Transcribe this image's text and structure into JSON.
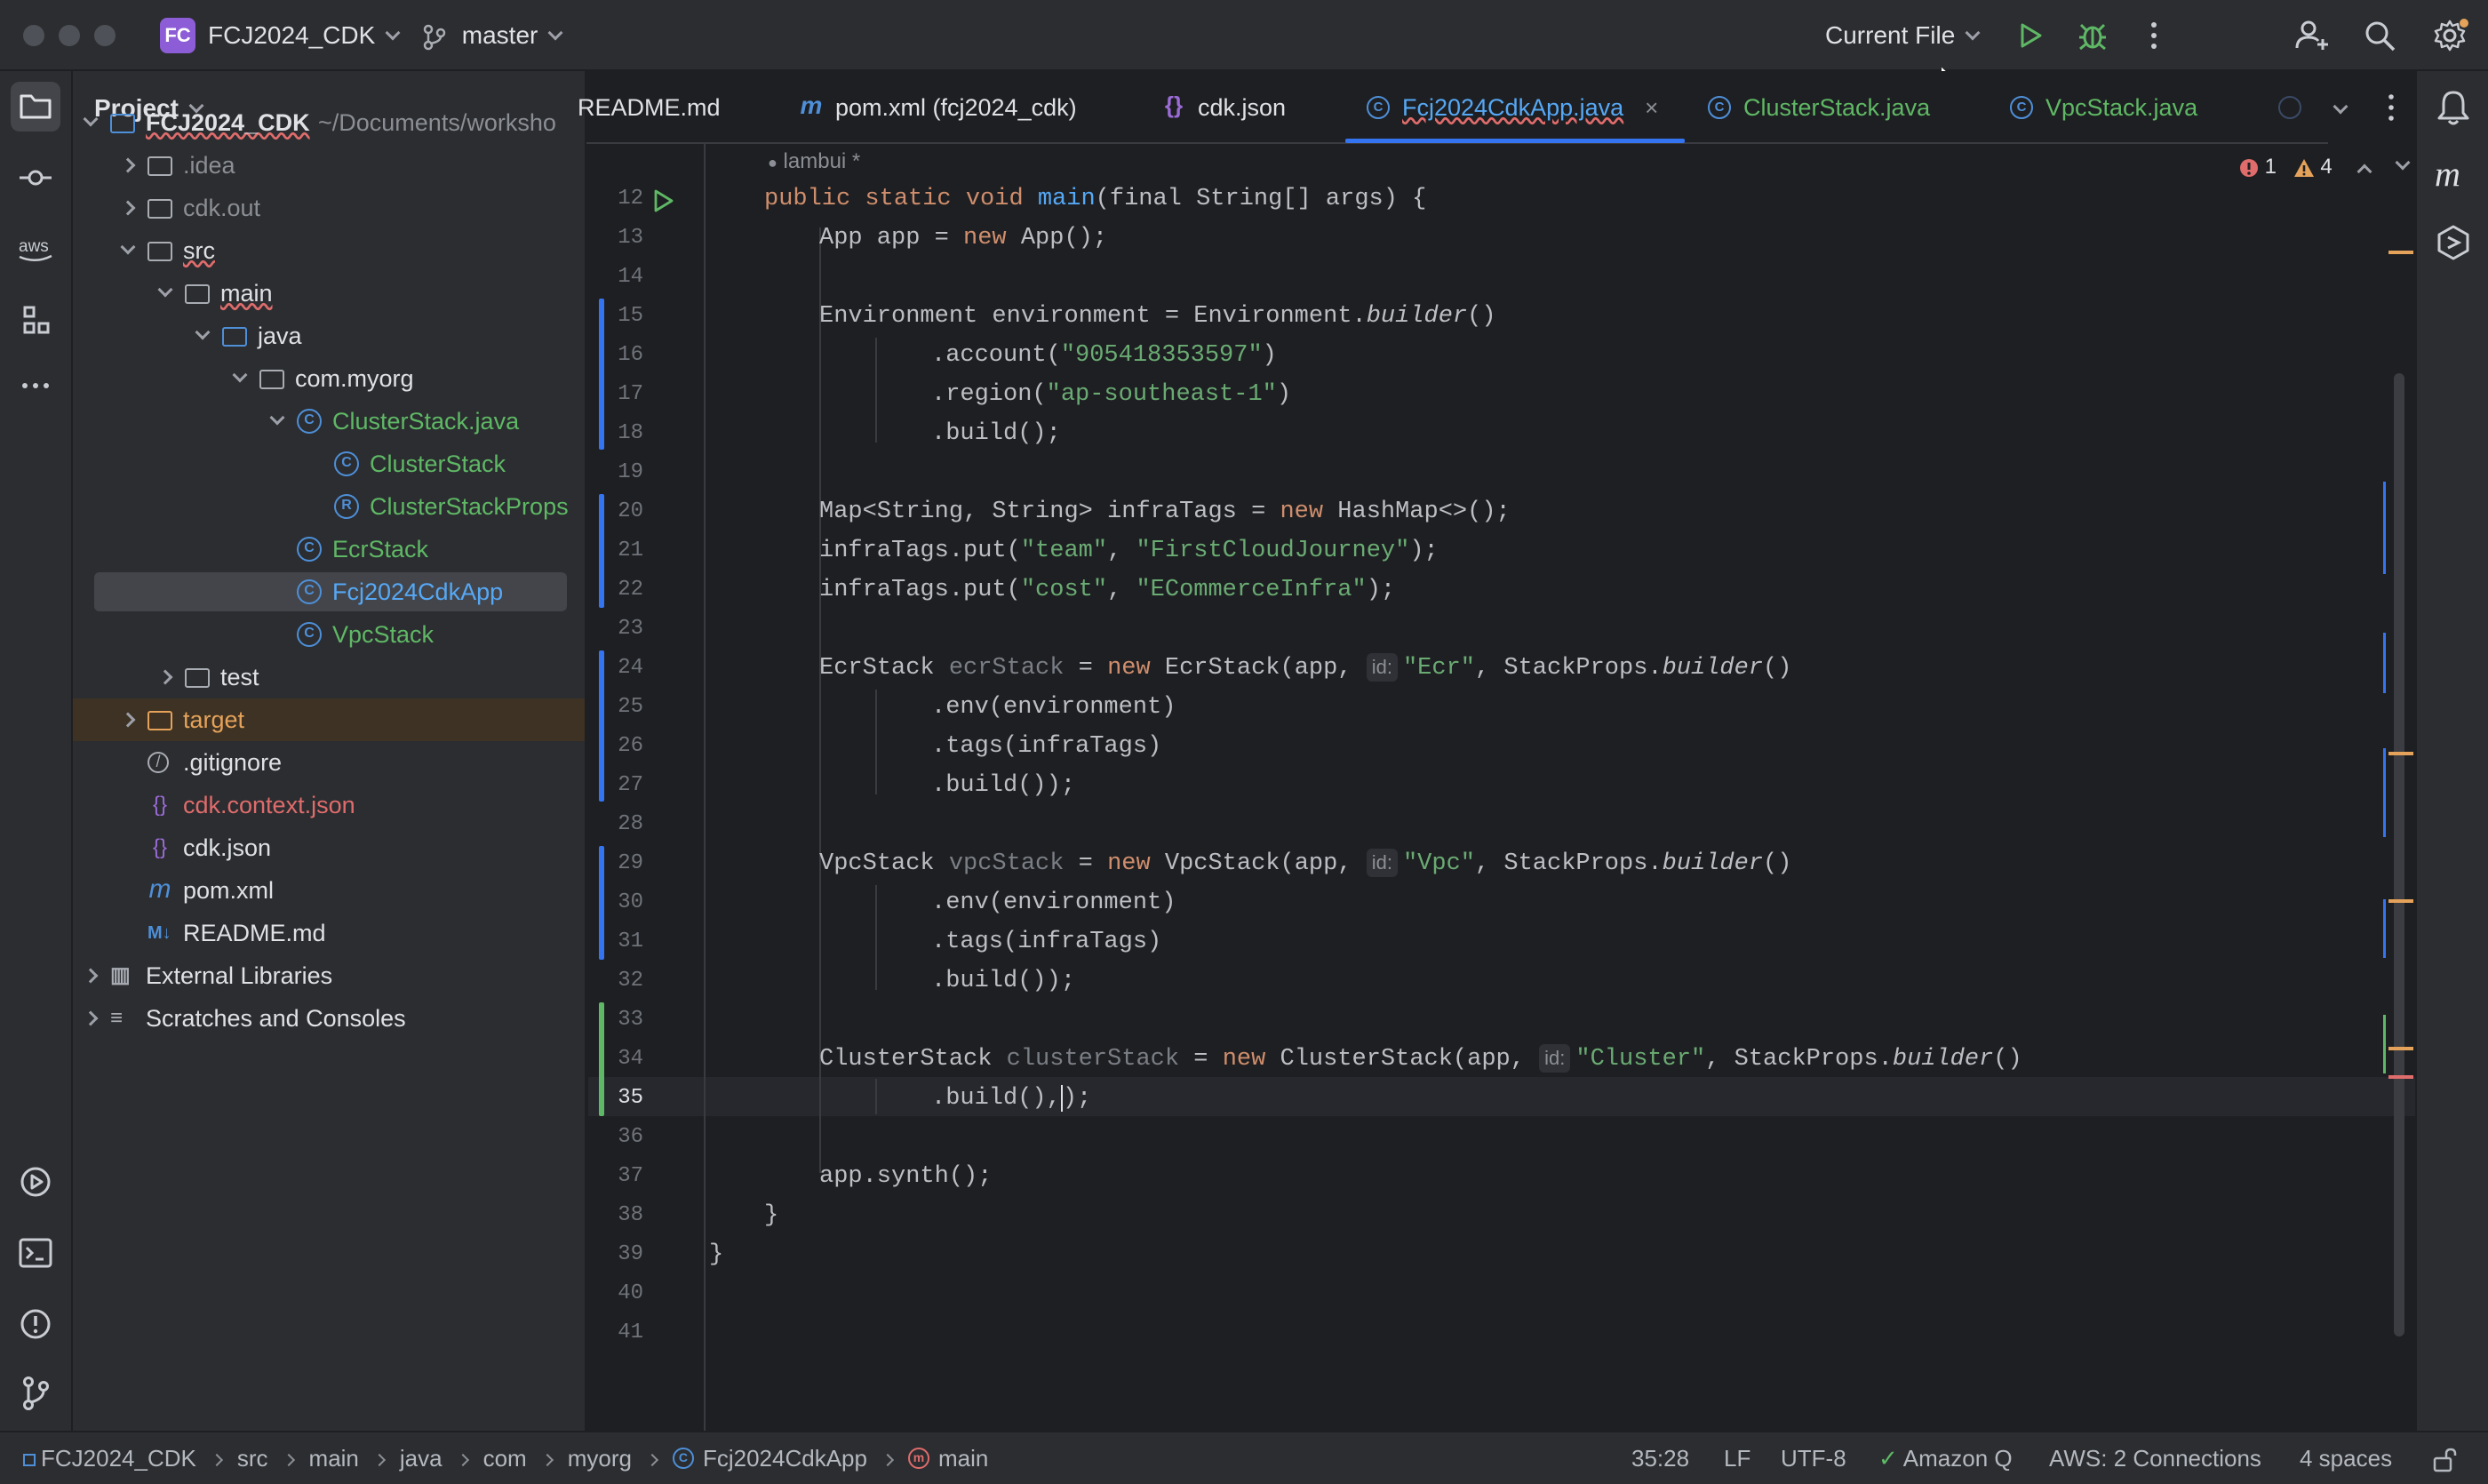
{
  "titlebar": {
    "project_badge": "FC",
    "project_name": "FCJ2024_CDK",
    "branch": "master",
    "run_config": "Current File"
  },
  "project_panel": {
    "title": "Project",
    "tree": [
      {
        "label": "FCJ2024_CDK",
        "suffix": "~/Documents/worksho",
        "depth": 0,
        "state": "open",
        "icon": "module-icon",
        "style": "bold"
      },
      {
        "label": ".idea",
        "depth": 1,
        "state": "closed",
        "icon": "folder-icon",
        "style": "grey"
      },
      {
        "label": "cdk.out",
        "depth": 1,
        "state": "closed",
        "icon": "folder-icon",
        "style": "grey"
      },
      {
        "label": "src",
        "depth": 1,
        "state": "open",
        "icon": "folder-icon",
        "style": "normal"
      },
      {
        "label": "main",
        "depth": 2,
        "state": "open",
        "icon": "folder-icon",
        "style": "normal"
      },
      {
        "label": "java",
        "depth": 3,
        "state": "open",
        "icon": "source-folder-icon",
        "style": "normal"
      },
      {
        "label": "com.myorg",
        "depth": 4,
        "state": "open",
        "icon": "package-icon",
        "style": "normal"
      },
      {
        "label": "ClusterStack.java",
        "depth": 5,
        "state": "open",
        "icon": "class-icon",
        "style": "green"
      },
      {
        "label": "ClusterStack",
        "depth": 6,
        "state": "none",
        "icon": "class-icon",
        "style": "green"
      },
      {
        "label": "ClusterStackProps",
        "depth": 6,
        "state": "none",
        "icon": "record-icon",
        "style": "green"
      },
      {
        "label": "EcrStack",
        "depth": 5,
        "state": "none",
        "icon": "class-icon",
        "style": "green"
      },
      {
        "label": "Fcj2024CdkApp",
        "depth": 5,
        "state": "none",
        "icon": "class-icon",
        "style": "blue-selected"
      },
      {
        "label": "VpcStack",
        "depth": 5,
        "state": "none",
        "icon": "class-icon",
        "style": "green"
      },
      {
        "label": "test",
        "depth": 2,
        "state": "closed",
        "icon": "folder-icon",
        "style": "normal"
      },
      {
        "label": "target",
        "depth": 1,
        "state": "closed",
        "icon": "folder-icon",
        "style": "orange"
      },
      {
        "label": ".gitignore",
        "depth": 1,
        "state": "none",
        "icon": "ignore-icon",
        "style": "normal"
      },
      {
        "label": "cdk.context.json",
        "depth": 1,
        "state": "none",
        "icon": "json-icon",
        "style": "red"
      },
      {
        "label": "cdk.json",
        "depth": 1,
        "state": "none",
        "icon": "json-icon",
        "style": "normal"
      },
      {
        "label": "pom.xml",
        "depth": 1,
        "state": "none",
        "icon": "maven-icon",
        "style": "normal"
      },
      {
        "label": "README.md",
        "depth": 1,
        "state": "none",
        "icon": "markdown-icon",
        "style": "normal"
      },
      {
        "label": "External Libraries",
        "depth": 0,
        "state": "closed",
        "icon": "library-icon",
        "style": "normal"
      },
      {
        "label": "Scratches and Consoles",
        "depth": 0,
        "state": "closed",
        "icon": "scratches-icon",
        "style": "normal"
      }
    ]
  },
  "tabs": [
    {
      "label": "README.md"
    },
    {
      "label": "pom.xml (fcj2024_cdk)"
    },
    {
      "label": "cdk.json"
    },
    {
      "label": "Fcj2024CdkApp.java",
      "active": true
    },
    {
      "label": "ClusterStack.java"
    },
    {
      "label": "VpcStack.java"
    }
  ],
  "editor": {
    "author_hint": "lambui *",
    "problems": {
      "errors": "1",
      "warnings": "4"
    },
    "line_numbers": [
      "12",
      "13",
      "14",
      "15",
      "16",
      "17",
      "18",
      "19",
      "20",
      "21",
      "22",
      "23",
      "24",
      "25",
      "26",
      "27",
      "28",
      "29",
      "30",
      "31",
      "32",
      "33",
      "34",
      "35",
      "36",
      "37",
      "38",
      "39",
      "40",
      "41"
    ],
    "code": {
      "l12": {
        "kw1": "public static void ",
        "fn": "main",
        "rest": "(final String[] args) {"
      },
      "l13": {
        "a": "App app = ",
        "kw": "new",
        "b": " App();"
      },
      "l15": {
        "a": "Environment environment = Environment.",
        "it": "builder",
        "b": "()"
      },
      "l16": {
        "a": ".account(",
        "s": "\"905418353597\"",
        "b": ")"
      },
      "l17": {
        "a": ".region(",
        "s": "\"ap-southeast-1\"",
        "b": ")"
      },
      "l18": {
        "a": ".build();"
      },
      "l20": {
        "a": "Map<String, String> infraTags = ",
        "kw": "new",
        "b": " HashMap<>();"
      },
      "l21": {
        "a": "infraTags.put(",
        "s1": "\"team\"",
        "b": ", ",
        "s2": "\"FirstCloudJourney\"",
        "c": ");"
      },
      "l22": {
        "a": "infraTags.put(",
        "s1": "\"cost\"",
        "b": ", ",
        "s2": "\"ECommerceInfra\"",
        "c": ");"
      },
      "l24": {
        "a": "EcrStack ",
        "var": "ecrStack",
        "b": " = ",
        "kw": "new",
        "c": " EcrStack(app, ",
        "hint": "id:",
        "s": "\"Ecr\"",
        "d": ", StackProps.",
        "it": "builder",
        "e": "()"
      },
      "l25": {
        "a": ".env(environment)"
      },
      "l26": {
        "a": ".tags(infraTags)"
      },
      "l27": {
        "a": ".build());"
      },
      "l29": {
        "a": "VpcStack ",
        "var": "vpcStack",
        "b": " = ",
        "kw": "new",
        "c": " VpcStack(app, ",
        "hint": "id:",
        "s": "\"Vpc\"",
        "d": ", StackProps.",
        "it": "builder",
        "e": "()"
      },
      "l30": {
        "a": ".env(environment)"
      },
      "l31": {
        "a": ".tags(infraTags)"
      },
      "l32": {
        "a": ".build());"
      },
      "l34": {
        "a": "ClusterStack ",
        "var": "clusterStack",
        "b": " = ",
        "kw": "new",
        "c": " ClusterStack(app, ",
        "hint": "id:",
        "s": "\"Cluster\"",
        "d": ", StackProps.",
        "it": "builder",
        "e": "()"
      },
      "l35": {
        "a": ".build(),",
        "b": ");"
      },
      "l37": {
        "a": "app.synth();"
      },
      "l38": {
        "a": "}"
      },
      "l39": {
        "a": "}"
      }
    }
  },
  "statusbar": {
    "breadcrumbs": [
      "FCJ2024_CDK",
      "src",
      "main",
      "java",
      "com",
      "myorg",
      "Fcj2024CdkApp",
      "main"
    ],
    "position": "35:28",
    "line_sep": "LF",
    "encoding": "UTF-8",
    "amazon_q": "Amazon Q",
    "aws": "AWS: 2 Connections",
    "indent": "4 spaces"
  },
  "colors": {
    "accent": "#3574f0",
    "class_green": "#5fb865",
    "error": "#e06c6c",
    "warning": "#e5a25a",
    "keyword": "#cf8e6d",
    "string": "#6aab73"
  }
}
